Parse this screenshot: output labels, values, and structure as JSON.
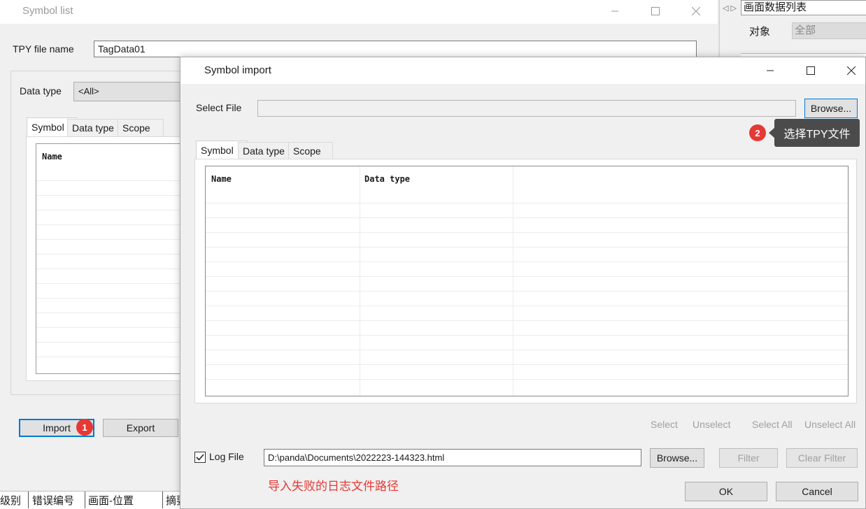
{
  "symbol_list": {
    "title": "Symbol list",
    "tpy_label": "TPY file name",
    "tpy_value": "TagData01",
    "data_type_label": "Data type",
    "data_type_value": "<All>",
    "tabs": [
      "Symbol",
      "Data type",
      "Scope"
    ],
    "col_name": "Name",
    "import_label": "Import",
    "export_label": "Export"
  },
  "right_panel": {
    "title": "画面数据列表",
    "object_label": "对象",
    "object_value": "全部"
  },
  "bottom_bar": {
    "columns": [
      "级别",
      "错误编号",
      "画面-位置",
      "摘要"
    ]
  },
  "symbol_import": {
    "title": "Symbol import",
    "select_file_label": "Select File",
    "select_file_value": "",
    "browse_label": "Browse...",
    "tabs": [
      "Symbol",
      "Data type",
      "Scope"
    ],
    "columns": [
      "Name",
      "Data type"
    ],
    "select_label": "Select",
    "unselect_label": "Unselect",
    "select_all_label": "Select All",
    "unselect_all_label": "Unselect All",
    "log_file_label": "Log File",
    "log_file_checked": true,
    "log_file_path": "D:\\panda\\Documents\\2022223-144323.html",
    "log_browse_label": "Browse...",
    "filter_label": "Filter",
    "clear_filter_label": "Clear Filter",
    "ok_label": "OK",
    "cancel_label": "Cancel"
  },
  "annotations": {
    "badge1": "1",
    "badge2": "2",
    "tooltip2": "选择TPY文件",
    "log_note": "导入失败的日志文件路径",
    "badge_color": "#e53935",
    "note_color": "#e53935"
  }
}
